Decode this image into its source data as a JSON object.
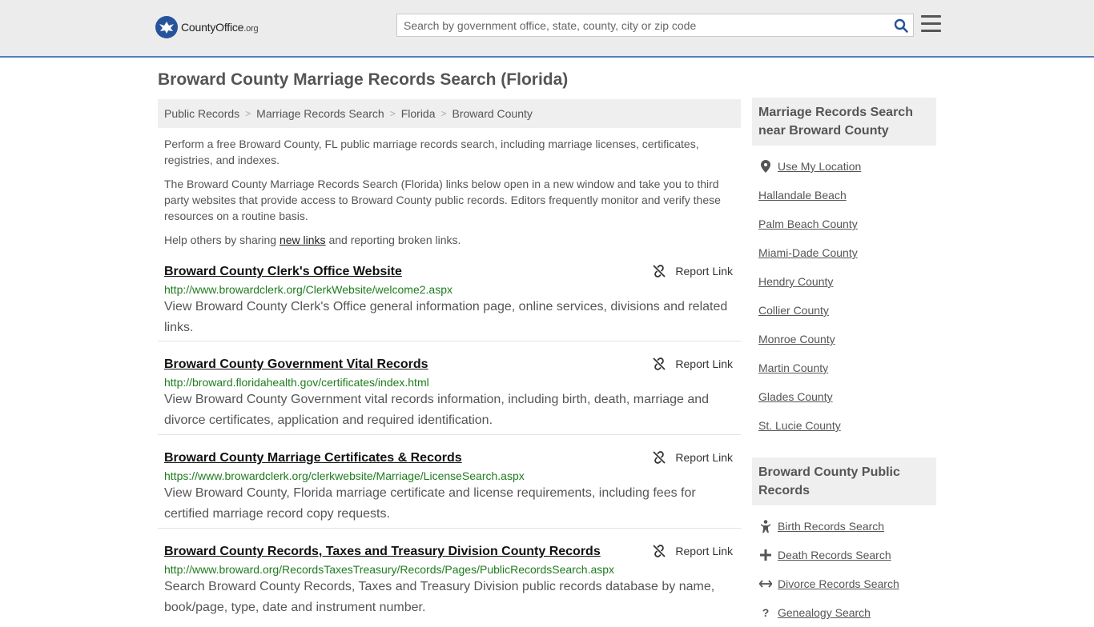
{
  "header": {
    "logo_brand": "CountyOffice",
    "logo_tld": ".org",
    "search_placeholder": "Search by government office, state, county, city or zip code"
  },
  "page_title": "Broward County Marriage Records Search (Florida)",
  "breadcrumb": [
    "Public Records",
    "Marriage Records Search",
    "Florida",
    "Broward County"
  ],
  "intro": {
    "p1": "Perform a free Broward County, FL public marriage records search, including marriage licenses, certificates, registries, and indexes.",
    "p2": "The Broward County Marriage Records Search (Florida) links below open in a new window and take you to third party websites that provide access to Broward County public records. Editors frequently monitor and verify these resources on a routine basis.",
    "p3_before": "Help others by sharing ",
    "p3_link": "new links",
    "p3_after": " and reporting broken links."
  },
  "report_label": "Report Link",
  "results": [
    {
      "title": "Broward County Clerk's Office Website",
      "url": "http://www.browardclerk.org/ClerkWebsite/welcome2.aspx",
      "desc": "View Broward County Clerk's Office general information page, online services, divisions and related links."
    },
    {
      "title": "Broward County Government Vital Records",
      "url": "http://broward.floridahealth.gov/certificates/index.html",
      "desc": "View Broward County Government vital records information, including birth, death, marriage and divorce certificates, application and required identification."
    },
    {
      "title": "Broward County Marriage Certificates & Records",
      "url": "https://www.browardclerk.org/clerkwebsite/Marriage/LicenseSearch.aspx",
      "desc": "View Broward County, Florida marriage certificate and license requirements, including fees for certified marriage record copy requests."
    },
    {
      "title": "Broward County Records, Taxes and Treasury Division County Records",
      "url": "http://www.broward.org/RecordsTaxesTreasury/Records/Pages/PublicRecordsSearch.aspx",
      "desc": "Search Broward County Records, Taxes and Treasury Division public records database by name, book/page, type, date and instrument number."
    }
  ],
  "sidebar": {
    "nearby_heading": "Marriage Records Search near Broward County",
    "use_location": "Use My Location",
    "nearby": [
      "Hallandale Beach",
      "Palm Beach County",
      "Miami-Dade County",
      "Hendry County",
      "Collier County",
      "Monroe County",
      "Martin County",
      "Glades County",
      "St. Lucie County"
    ],
    "public_heading": "Broward County Public Records",
    "public": [
      {
        "label": "Birth Records Search",
        "icon": "baby-icon"
      },
      {
        "label": "Death Records Search",
        "icon": "cross-icon"
      },
      {
        "label": "Divorce Records Search",
        "icon": "split-arrows-icon"
      },
      {
        "label": "Genealogy Search",
        "icon": "question-icon"
      }
    ]
  }
}
